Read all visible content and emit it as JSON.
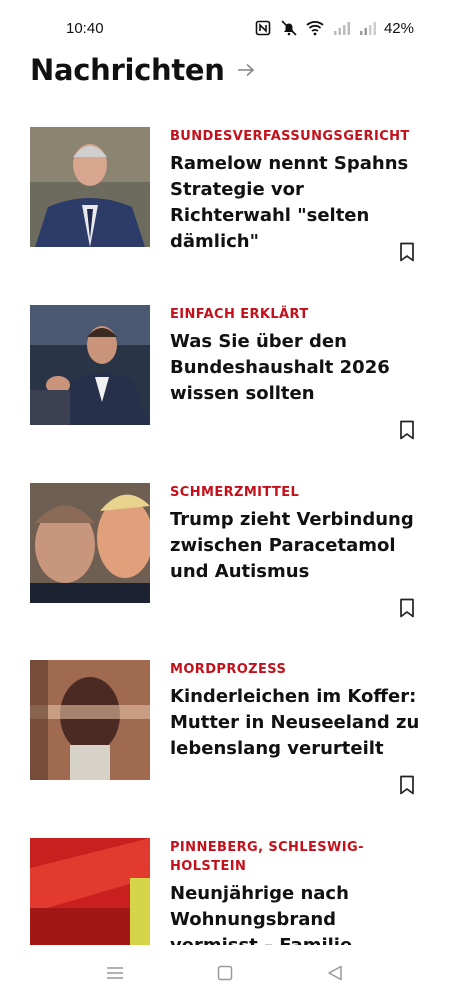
{
  "status": {
    "time": "10:40",
    "battery": "42%",
    "icons": [
      "nfc-icon",
      "mute-icon",
      "wifi-icon",
      "signal-icon",
      "signal-icon"
    ]
  },
  "header": {
    "title": "Nachrichten",
    "arrow_icon": "arrow-right-icon"
  },
  "colors": {
    "kicker": "#c4101a",
    "text": "#111111",
    "background": "#ffffff"
  },
  "articles": [
    {
      "kicker": "BUNDESVERFASSUNGSGERICHT",
      "headline": "Ramelow nennt Spahns Strategie vor Richterwahl \"selten dämlich\"",
      "bookmark_icon": "bookmark-icon"
    },
    {
      "kicker": "EINFACH ERKLÄRT",
      "headline": "Was Sie über den Bundeshaushalt 2026 wissen sollten",
      "bookmark_icon": "bookmark-icon"
    },
    {
      "kicker": "SCHMERZMITTEL",
      "headline": "Trump zieht Verbindung zwischen Paracetamol und Autismus",
      "bookmark_icon": "bookmark-icon"
    },
    {
      "kicker": "MORDPROZESS",
      "headline": "Kinderleichen im Koffer: Mutter in Neuseeland zu lebenslang verurteilt",
      "bookmark_icon": "bookmark-icon"
    },
    {
      "kicker": "PINNEBERG, SCHLESWIG-HOLSTEIN",
      "headline": "Neunjährige nach Wohnungsbrand vermisst – Familie schwer verletzt",
      "bookmark_icon": "bookmark-icon"
    }
  ],
  "nav": {
    "icons": [
      "menu-icon",
      "home-icon",
      "back-icon"
    ]
  }
}
